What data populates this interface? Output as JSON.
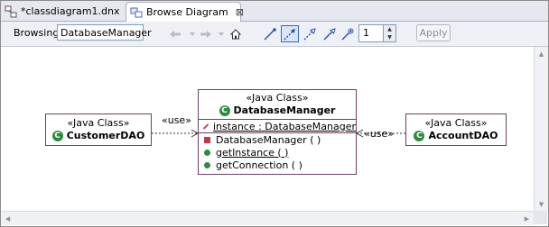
{
  "tabs": [
    {
      "label": "*classdiagram1.dnx"
    },
    {
      "label": "Browse Diagram",
      "close": "⊠"
    }
  ],
  "toolbar": {
    "browsing_label": "Browsing:",
    "browsing_value": "DatabaseManager",
    "depth_value": "1",
    "apply_label": "Apply"
  },
  "diagram": {
    "center": {
      "stereotype": "«Java Class»",
      "name": "DatabaseManager",
      "field": "instance : DatabaseManager",
      "methods": [
        "DatabaseManager ( )",
        "getInstance ( )",
        "getConnection ( )"
      ]
    },
    "left": {
      "stereotype": "«Java Class»",
      "name": "CustomerDAO"
    },
    "right": {
      "stereotype": "«Java Class»",
      "name": "AccountDAO"
    },
    "left_rel": "«use»",
    "right_rel": "«use»"
  }
}
